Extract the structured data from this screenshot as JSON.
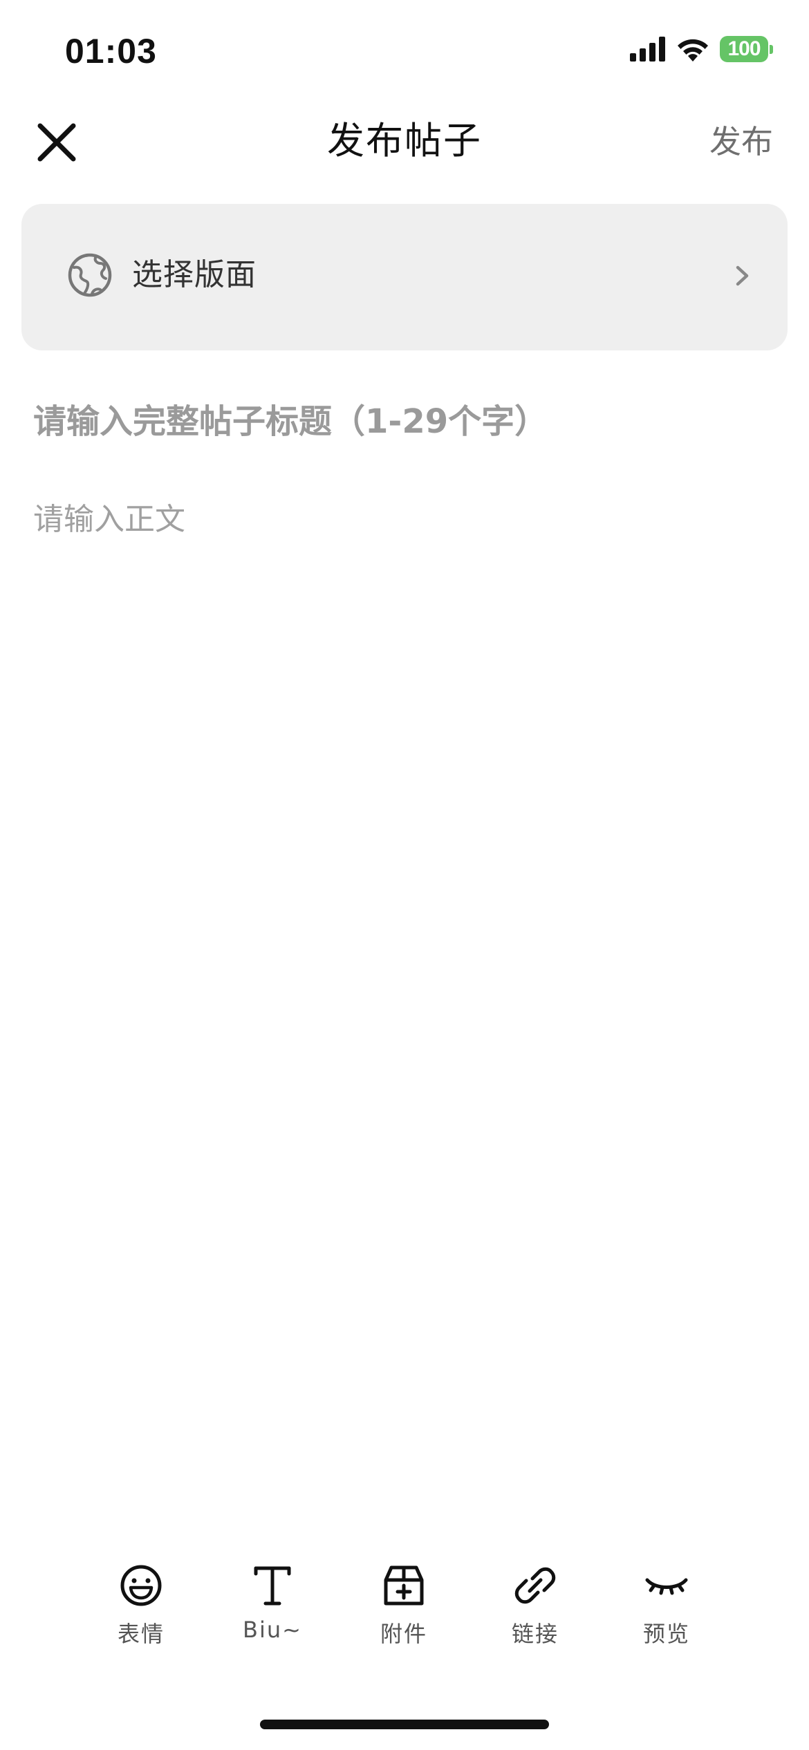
{
  "status_bar": {
    "time": "01:03",
    "battery": "100"
  },
  "nav": {
    "title": "发布帖子",
    "publish_label": "发布"
  },
  "board_selector": {
    "label": "选择版面",
    "icon": "globe-icon"
  },
  "editor": {
    "title_placeholder": "请输入完整帖子标题（1-29个字）",
    "body_placeholder": "请输入正文"
  },
  "toolbar": {
    "items": [
      {
        "label": "表情",
        "icon": "emoji-icon"
      },
      {
        "label": "Biu~",
        "icon": "text-format-icon"
      },
      {
        "label": "附件",
        "icon": "attachment-icon"
      },
      {
        "label": "链接",
        "icon": "link-icon"
      },
      {
        "label": "预览",
        "icon": "preview-eye-icon"
      }
    ]
  },
  "colors": {
    "battery": "#65c466",
    "selector_background": "#efefef",
    "placeholder": "#9a9a9a"
  }
}
